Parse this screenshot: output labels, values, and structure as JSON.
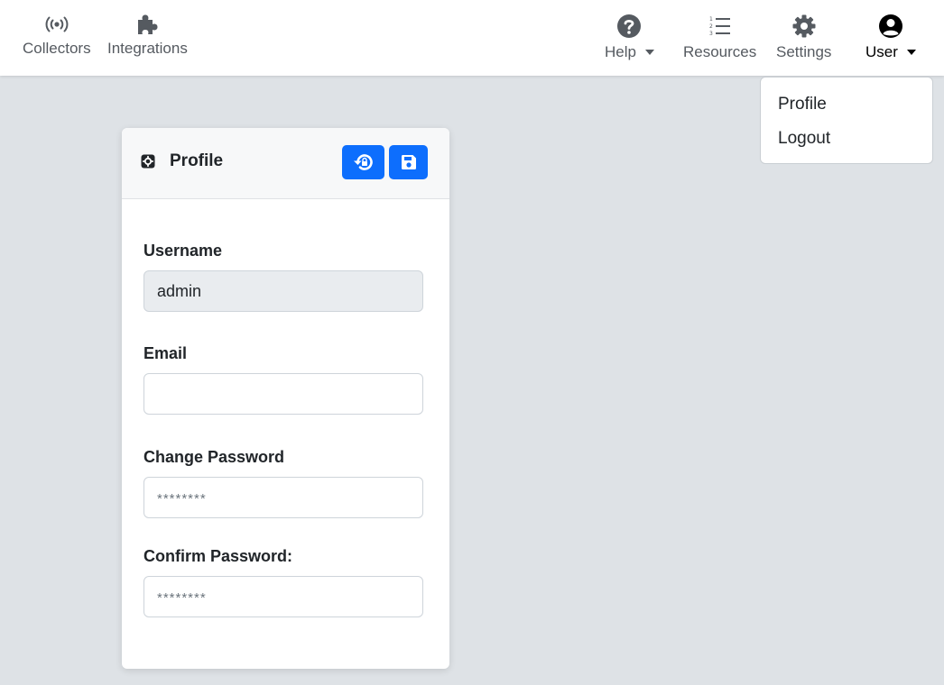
{
  "navbar": {
    "left_items": [
      {
        "label": "Collectors",
        "icon": "broadcast-icon"
      },
      {
        "label": "Integrations",
        "icon": "puzzle-icon"
      }
    ],
    "right_items": [
      {
        "label": "Help",
        "icon": "question-circle-icon",
        "has_caret": true
      },
      {
        "label": "Resources",
        "icon": "ordered-list-icon",
        "has_caret": false
      },
      {
        "label": "Settings",
        "icon": "gear-icon",
        "has_caret": false
      },
      {
        "label": "User",
        "icon": "user-circle-icon",
        "has_caret": true,
        "active": true
      }
    ]
  },
  "user_menu": {
    "items": [
      {
        "label": "Profile"
      },
      {
        "label": "Logout"
      }
    ]
  },
  "profile_card": {
    "title": "Profile",
    "title_icon": "cog-box-icon",
    "buttons": {
      "reset_icon": "reset-lock-icon",
      "save_icon": "floppy-disk-icon"
    },
    "fields": {
      "username": {
        "label": "Username",
        "value": "admin"
      },
      "email": {
        "label": "Email",
        "value": ""
      },
      "change_password": {
        "label": "Change Password",
        "placeholder": "********"
      },
      "confirm_password": {
        "label": "Confirm Password:",
        "placeholder": "********"
      }
    }
  },
  "colors": {
    "primary": "#0d6efd",
    "page_background": "#dee2e6",
    "navbar_text": "#555a60"
  }
}
